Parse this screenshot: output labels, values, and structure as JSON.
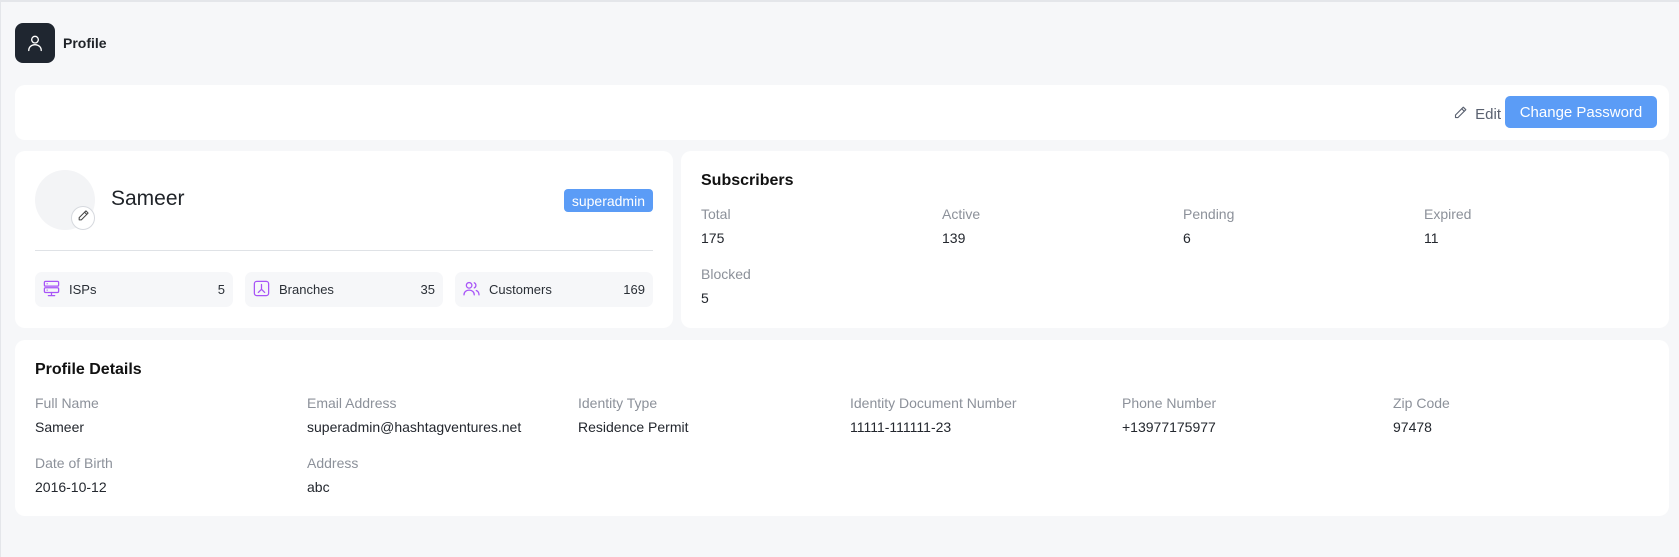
{
  "header": {
    "title": "Profile",
    "icon": "user-icon"
  },
  "actions": {
    "edit_label": "Edit",
    "change_password_label": "Change Password"
  },
  "profile": {
    "name": "Sameer",
    "role": "superadmin",
    "stats": [
      {
        "label": "ISPs",
        "value": "5",
        "icon": "server-icon"
      },
      {
        "label": "Branches",
        "value": "35",
        "icon": "branch-icon"
      },
      {
        "label": "Customers",
        "value": "169",
        "icon": "users-icon"
      }
    ]
  },
  "subscribers": {
    "title": "Subscribers",
    "fields": [
      {
        "label": "Total",
        "value": "175"
      },
      {
        "label": "Active",
        "value": "139"
      },
      {
        "label": "Pending",
        "value": "6"
      },
      {
        "label": "Expired",
        "value": "11"
      },
      {
        "label": "Blocked",
        "value": "5"
      }
    ]
  },
  "details": {
    "title": "Profile Details",
    "fields": [
      {
        "label": "Full Name",
        "value": "Sameer"
      },
      {
        "label": "Email Address",
        "value": "superadmin@hashtagventures.net"
      },
      {
        "label": "Identity Type",
        "value": "Residence Permit"
      },
      {
        "label": "Identity Document Number",
        "value": "11111-111111-23"
      },
      {
        "label": "Phone Number",
        "value": "+13977175977"
      },
      {
        "label": "Zip Code",
        "value": "97478"
      },
      {
        "label": "Date of Birth",
        "value": "2016-10-12"
      },
      {
        "label": "Address",
        "value": "abc"
      }
    ]
  },
  "colors": {
    "accent": "#5b9cf6",
    "icon_purple": "#a855f7",
    "header_icon_bg": "#1f2630"
  }
}
